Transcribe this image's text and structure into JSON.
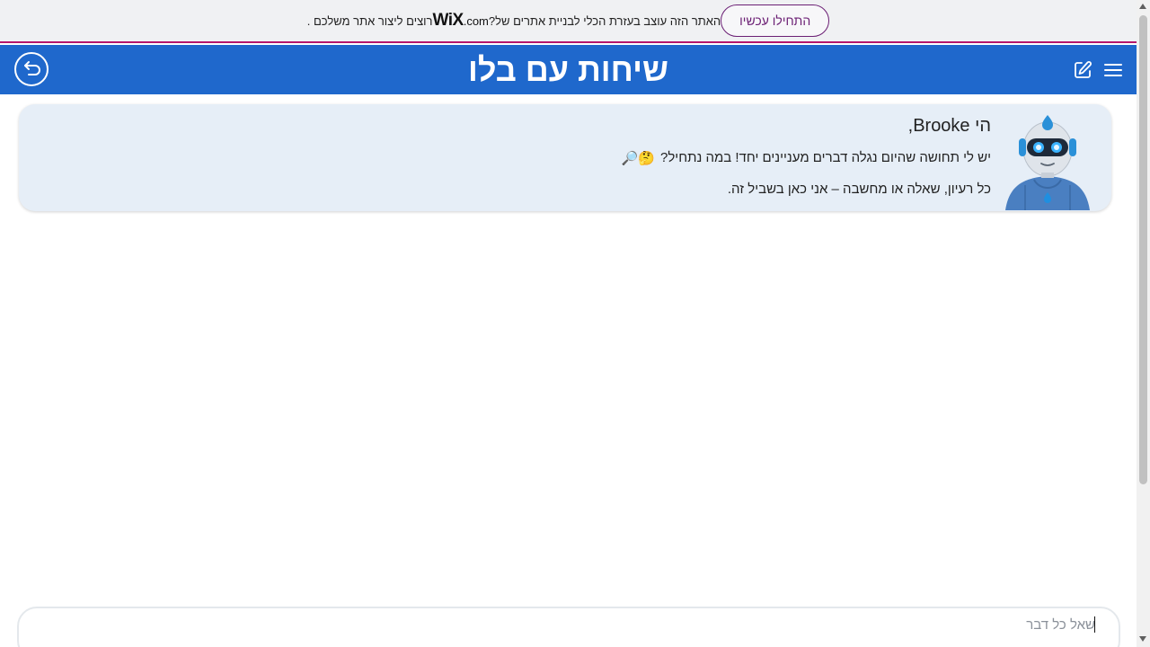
{
  "wix_banner": {
    "text_before": "?האתר הזה עוצב בעזרת הכלי לבניית אתרים של ",
    "logo": "WiX",
    "dotcom": ".com",
    "text_after": ". רוצים ליצור אתר משלכם",
    "cta_label": "התחילו עכשיו",
    "accent_color": "#b5176b"
  },
  "header": {
    "title": "שיחות עם בלו",
    "background": "#1f68cc",
    "back_icon": "back-arrow-icon",
    "edit_icon": "edit-icon",
    "menu_icon": "hamburger-menu-icon"
  },
  "message": {
    "greeting": "הי Brooke,",
    "line1": "יש לי תחושה שהיום נגלה דברים מעניינים יחד! במה נתחיל?",
    "line1_emojis": "🤔🔎",
    "line2": "כל רעיון, שאלה או מחשבה – אני כאן בשביל זה.",
    "avatar": "robot-avatar"
  },
  "chat_input": {
    "placeholder": "שאל כל דבר",
    "value": ""
  }
}
